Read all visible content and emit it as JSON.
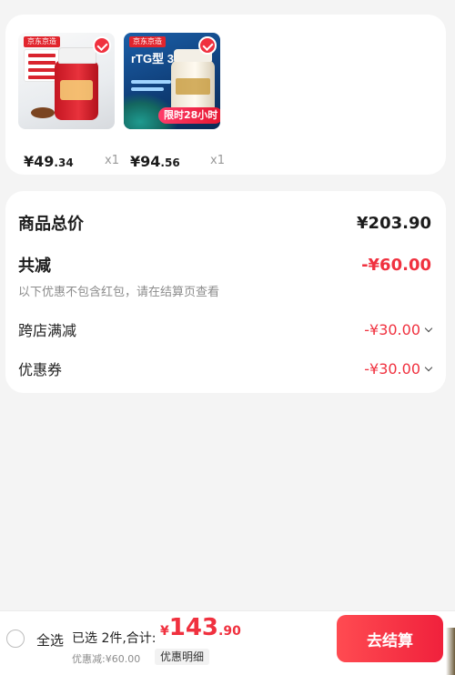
{
  "products": [
    {
      "brand_tag": "京东京造",
      "price_int": "¥49",
      "price_dec": ".34",
      "qty": "x1"
    },
    {
      "brand_tag": "京东京造",
      "image_text": "rTG型 3倍吸收",
      "promo_badge": "限时28小时",
      "price_int": "¥94",
      "price_dec": ".56",
      "qty": "x1"
    }
  ],
  "summary": {
    "total_label": "商品总价",
    "total_value": "¥203.90",
    "reduce_label": "共减",
    "reduce_value": "-¥60.00",
    "note": "以下优惠不包含红包，请在结算页查看",
    "shop_label": "跨店满减",
    "shop_value": "-¥30.00",
    "coupon_label": "优惠券",
    "coupon_value": "-¥30.00"
  },
  "bottom_bar": {
    "select_all": "全选",
    "selected_info": "已选 2件,合计:",
    "total_symbol": "¥",
    "total_int": "143",
    "total_dec": ".90",
    "discount_note": "优惠减:¥60.00",
    "detail_button": "优惠明细",
    "checkout_button": "去结算"
  },
  "colors": {
    "accent": "#f0313f",
    "background": "#f4f4f4"
  }
}
